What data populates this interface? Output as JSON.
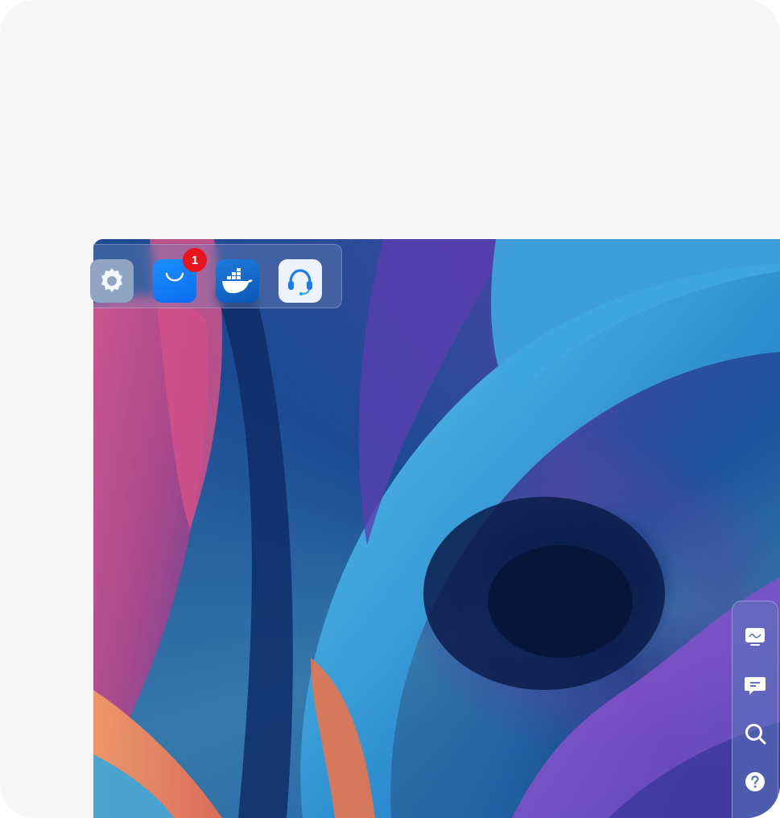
{
  "dock": {
    "apps": [
      {
        "name": "settings",
        "icon": "gear-icon"
      },
      {
        "name": "app-store",
        "icon": "shopping-bag-icon",
        "badge": "1"
      },
      {
        "name": "docker",
        "icon": "docker-whale-icon"
      },
      {
        "name": "support",
        "icon": "headset-icon"
      }
    ]
  },
  "rightbar": {
    "items": [
      {
        "icon": "monitor-icon"
      },
      {
        "icon": "chat-icon"
      },
      {
        "icon": "search-icon"
      },
      {
        "icon": "help-icon"
      }
    ]
  },
  "colors": {
    "badge": "#e8141e",
    "store": "#1a90ff",
    "docker": "#1f7bdc",
    "frame": "#f6f6f6"
  }
}
